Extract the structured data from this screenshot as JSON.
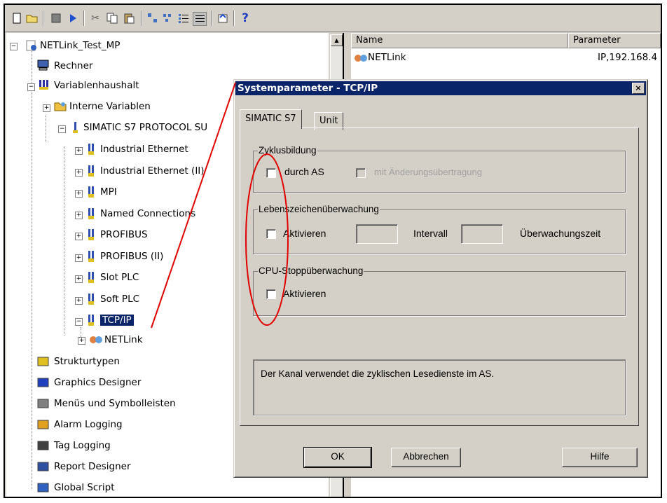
{
  "toolbar": {
    "icons": [
      "new-icon",
      "open-icon",
      "stop-icon",
      "run-icon",
      "cut-icon",
      "copy-icon",
      "paste-icon",
      "large-icons-icon",
      "small-icons-icon",
      "list-icon",
      "details-icon",
      "properties-icon",
      "help-icon"
    ]
  },
  "tree": {
    "project": "NETLink_Test_MP",
    "rechner": "Rechner",
    "variablenhaushalt": "Variablenhaushalt",
    "interne": "Interne Variablen",
    "simatic": "SIMATIC S7 PROTOCOL SU",
    "channels": [
      "Industrial Ethernet",
      "Industrial Ethernet (II)",
      "MPI",
      "Named Connections",
      "PROFIBUS",
      "PROFIBUS (II)",
      "Slot PLC",
      "Soft PLC",
      "TCP/IP"
    ],
    "netlink": "NETLink",
    "editors": [
      "Strukturtypen",
      "Graphics Designer",
      "Menüs und Symbolleisten",
      "Alarm Logging",
      "Tag Logging",
      "Report Designer",
      "Global Script"
    ]
  },
  "list": {
    "col_name": "Name",
    "col_parameter": "Parameter",
    "row_name": "NETLink",
    "row_parameter": "IP,192.168.4"
  },
  "dialog": {
    "title": "Systemparameter - TCP/IP",
    "close": "×",
    "tab1": "SIMATIC S7",
    "tab2": "Unit",
    "group1": "Zyklusbildung",
    "cb1": "durch AS",
    "cb2": "mit Änderungsübertragung",
    "group2": "Lebenszeichenüberwachung",
    "cb3": "Aktivieren",
    "intervall": "Intervall",
    "ueberwachungszeit": "Überwachungszeit",
    "group3": "CPU-Stoppüberwachung",
    "cb4": "Aktivieren",
    "info": "Der Kanal verwendet die zyklischen Lesedienste im AS.",
    "ok": "OK",
    "abbrechen": "Abbrechen",
    "hilfe": "Hilfe"
  },
  "colors": {
    "annotation": "#e00000",
    "selection": "#0a246a"
  }
}
